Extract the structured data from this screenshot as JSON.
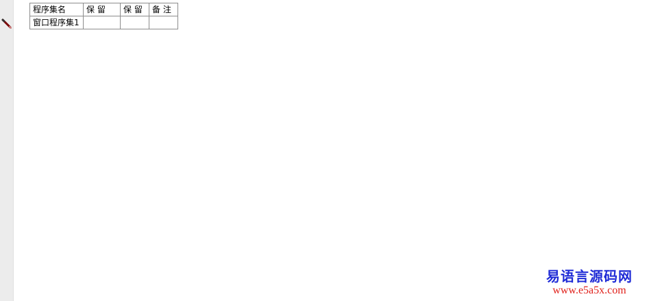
{
  "table": {
    "headers": [
      "程序集名",
      "保 留",
      "保 留",
      "备 注"
    ],
    "rows": [
      [
        "窗口程序集1",
        "",
        "",
        ""
      ]
    ]
  },
  "icons": {
    "gutter_marker": "pencil-icon"
  },
  "watermark": {
    "title": "易语言源码网",
    "url": "www.e5a5x.com",
    "title_color": "#1f2bd6",
    "url_color": "#e0201a"
  }
}
